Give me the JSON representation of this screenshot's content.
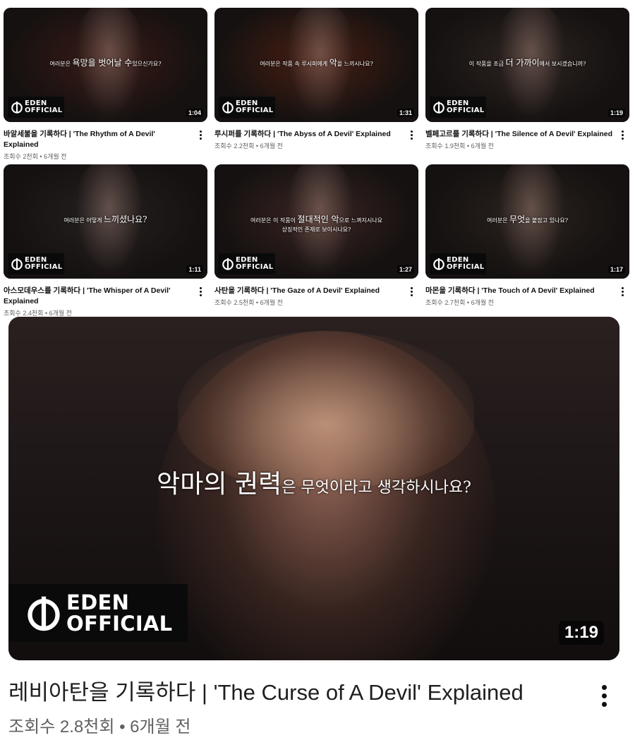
{
  "logo_text": [
    "EDEN",
    "OFFICIAL"
  ],
  "videos": [
    {
      "caption_pre": "여러분은",
      "caption_em": "욕망을 벗어날 수",
      "caption_post": "있으신가요?",
      "caption2": "",
      "duration": "1:04",
      "title": "바알세불을 기록하다 | 'The Rhythm of A Devil' Explained",
      "stats": "조회수 2천회 • 6개월 전",
      "tint": "#3a1a16"
    },
    {
      "caption_pre": "여러분은 작품 속 루시퍼에게",
      "caption_em": "악",
      "caption_post": "을 느끼시나요?",
      "caption2": "",
      "duration": "1:31",
      "title": "루시퍼를 기록하다 | 'The Abyss of A Devil' Explained",
      "stats": "조회수 2.2천회 • 6개월 전",
      "tint": "#4a1e12"
    },
    {
      "caption_pre": "이 작품을 조금",
      "caption_em": "더 가까이",
      "caption_post": "에서 보시겠습니까?",
      "caption2": "",
      "duration": "1:19",
      "title": "벨페고르를 기록하다 | 'The Silence of A Devil' Explained",
      "stats": "조회수 1.9천회 • 6개월 전",
      "tint": "#2c2320"
    },
    {
      "caption_pre": "여러분은 어떻게",
      "caption_em": "느끼셨나요?",
      "caption_post": "",
      "caption2": "",
      "duration": "1:11",
      "title": "아스모데우스를 기록하다 | 'The Whisper of A Devil' Explained",
      "stats": "조회수 2.4천회 • 6개월 전",
      "tint": "#242020"
    },
    {
      "caption_pre": "여러분은 이 작품이",
      "caption_em": "절대적인 악",
      "caption_post": "으로 느껴지시나요",
      "caption2": "상징적인 존재로 보이시나요?",
      "duration": "1:27",
      "title": "사탄을 기록하다 | 'The Gaze of A Devil' Explained",
      "stats": "조회수 2.5천회 • 6개월 전",
      "tint": "#3a2422"
    },
    {
      "caption_pre": "여러분은",
      "caption_em": "무엇",
      "caption_post": "을 붙잡고 있나요?",
      "caption2": "",
      "duration": "1:17",
      "title": "마몬을 기록하다 | 'The Touch of A Devil' Explained",
      "stats": "조회수 2.7천회 • 6개월 전",
      "tint": "#2a221e"
    }
  ],
  "featured": {
    "caption_em": "악마의 권력",
    "caption_post": "은 무엇이라고 생각하시나요?",
    "duration": "1:19",
    "title": "레비아탄을 기록하다 | 'The Curse of A Devil' Explained",
    "stats": "조회수 2.8천회 • 6개월 전"
  }
}
